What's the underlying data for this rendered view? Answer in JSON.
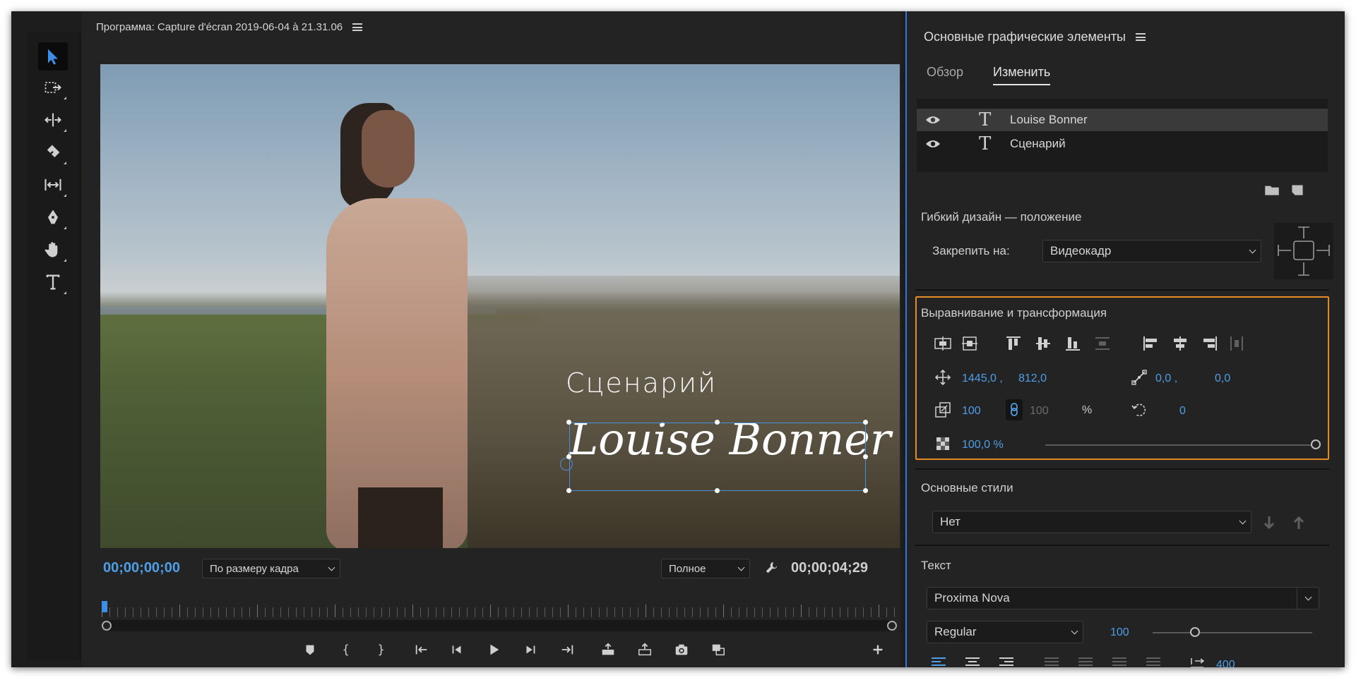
{
  "colors": {
    "accent": "#4e9ee8",
    "highlight_box": "#e68a26",
    "panel_border": "#2f78d6"
  },
  "tools": [
    "selection-tool-icon",
    "track-select-tool-icon",
    "ripple-edit-tool-icon",
    "razor-tool-icon",
    "slip-tool-icon",
    "pen-tool-icon",
    "hand-tool-icon",
    "type-tool-icon"
  ],
  "monitor": {
    "title": "Программа: Capture d'écran 2019-06-04 à 21.31.06",
    "overlay_subtitle": "Сценарий",
    "overlay_title": "Louise Bonner",
    "timecode_current": "00;00;00;00",
    "timecode_duration": "00;00;04;29",
    "fit_dropdown": "По размеру кадра",
    "quality_dropdown": "Полное"
  },
  "panel": {
    "title": "Основные графические элементы",
    "tabs": [
      {
        "label": "Обзор"
      },
      {
        "label": "Изменить"
      }
    ],
    "layers": [
      {
        "name": "Louise Bonner"
      },
      {
        "name": "Сценарий"
      }
    ],
    "responsive": {
      "title": "Гибкий дизайн — положение",
      "pin_label": "Закрепить на:",
      "pin_value": "Видеокадр"
    },
    "align": {
      "title": "Выравнивание и трансформация",
      "pos_x": "1445,0 ,",
      "pos_y": "812,0",
      "anchor_x": "0,0 ,",
      "anchor_y": "0,0",
      "scale": "100",
      "scale_linked": "100",
      "percent": "%",
      "rotation": "0",
      "opacity": "100,0 %",
      "opacity_fraction": 1.0
    },
    "styles": {
      "title": "Основные стили",
      "value": "Нет"
    },
    "text": {
      "title": "Текст",
      "font": "Proxima Nova",
      "style": "Regular",
      "size": "100",
      "size_fraction": 0.25,
      "tracking": "400"
    }
  }
}
